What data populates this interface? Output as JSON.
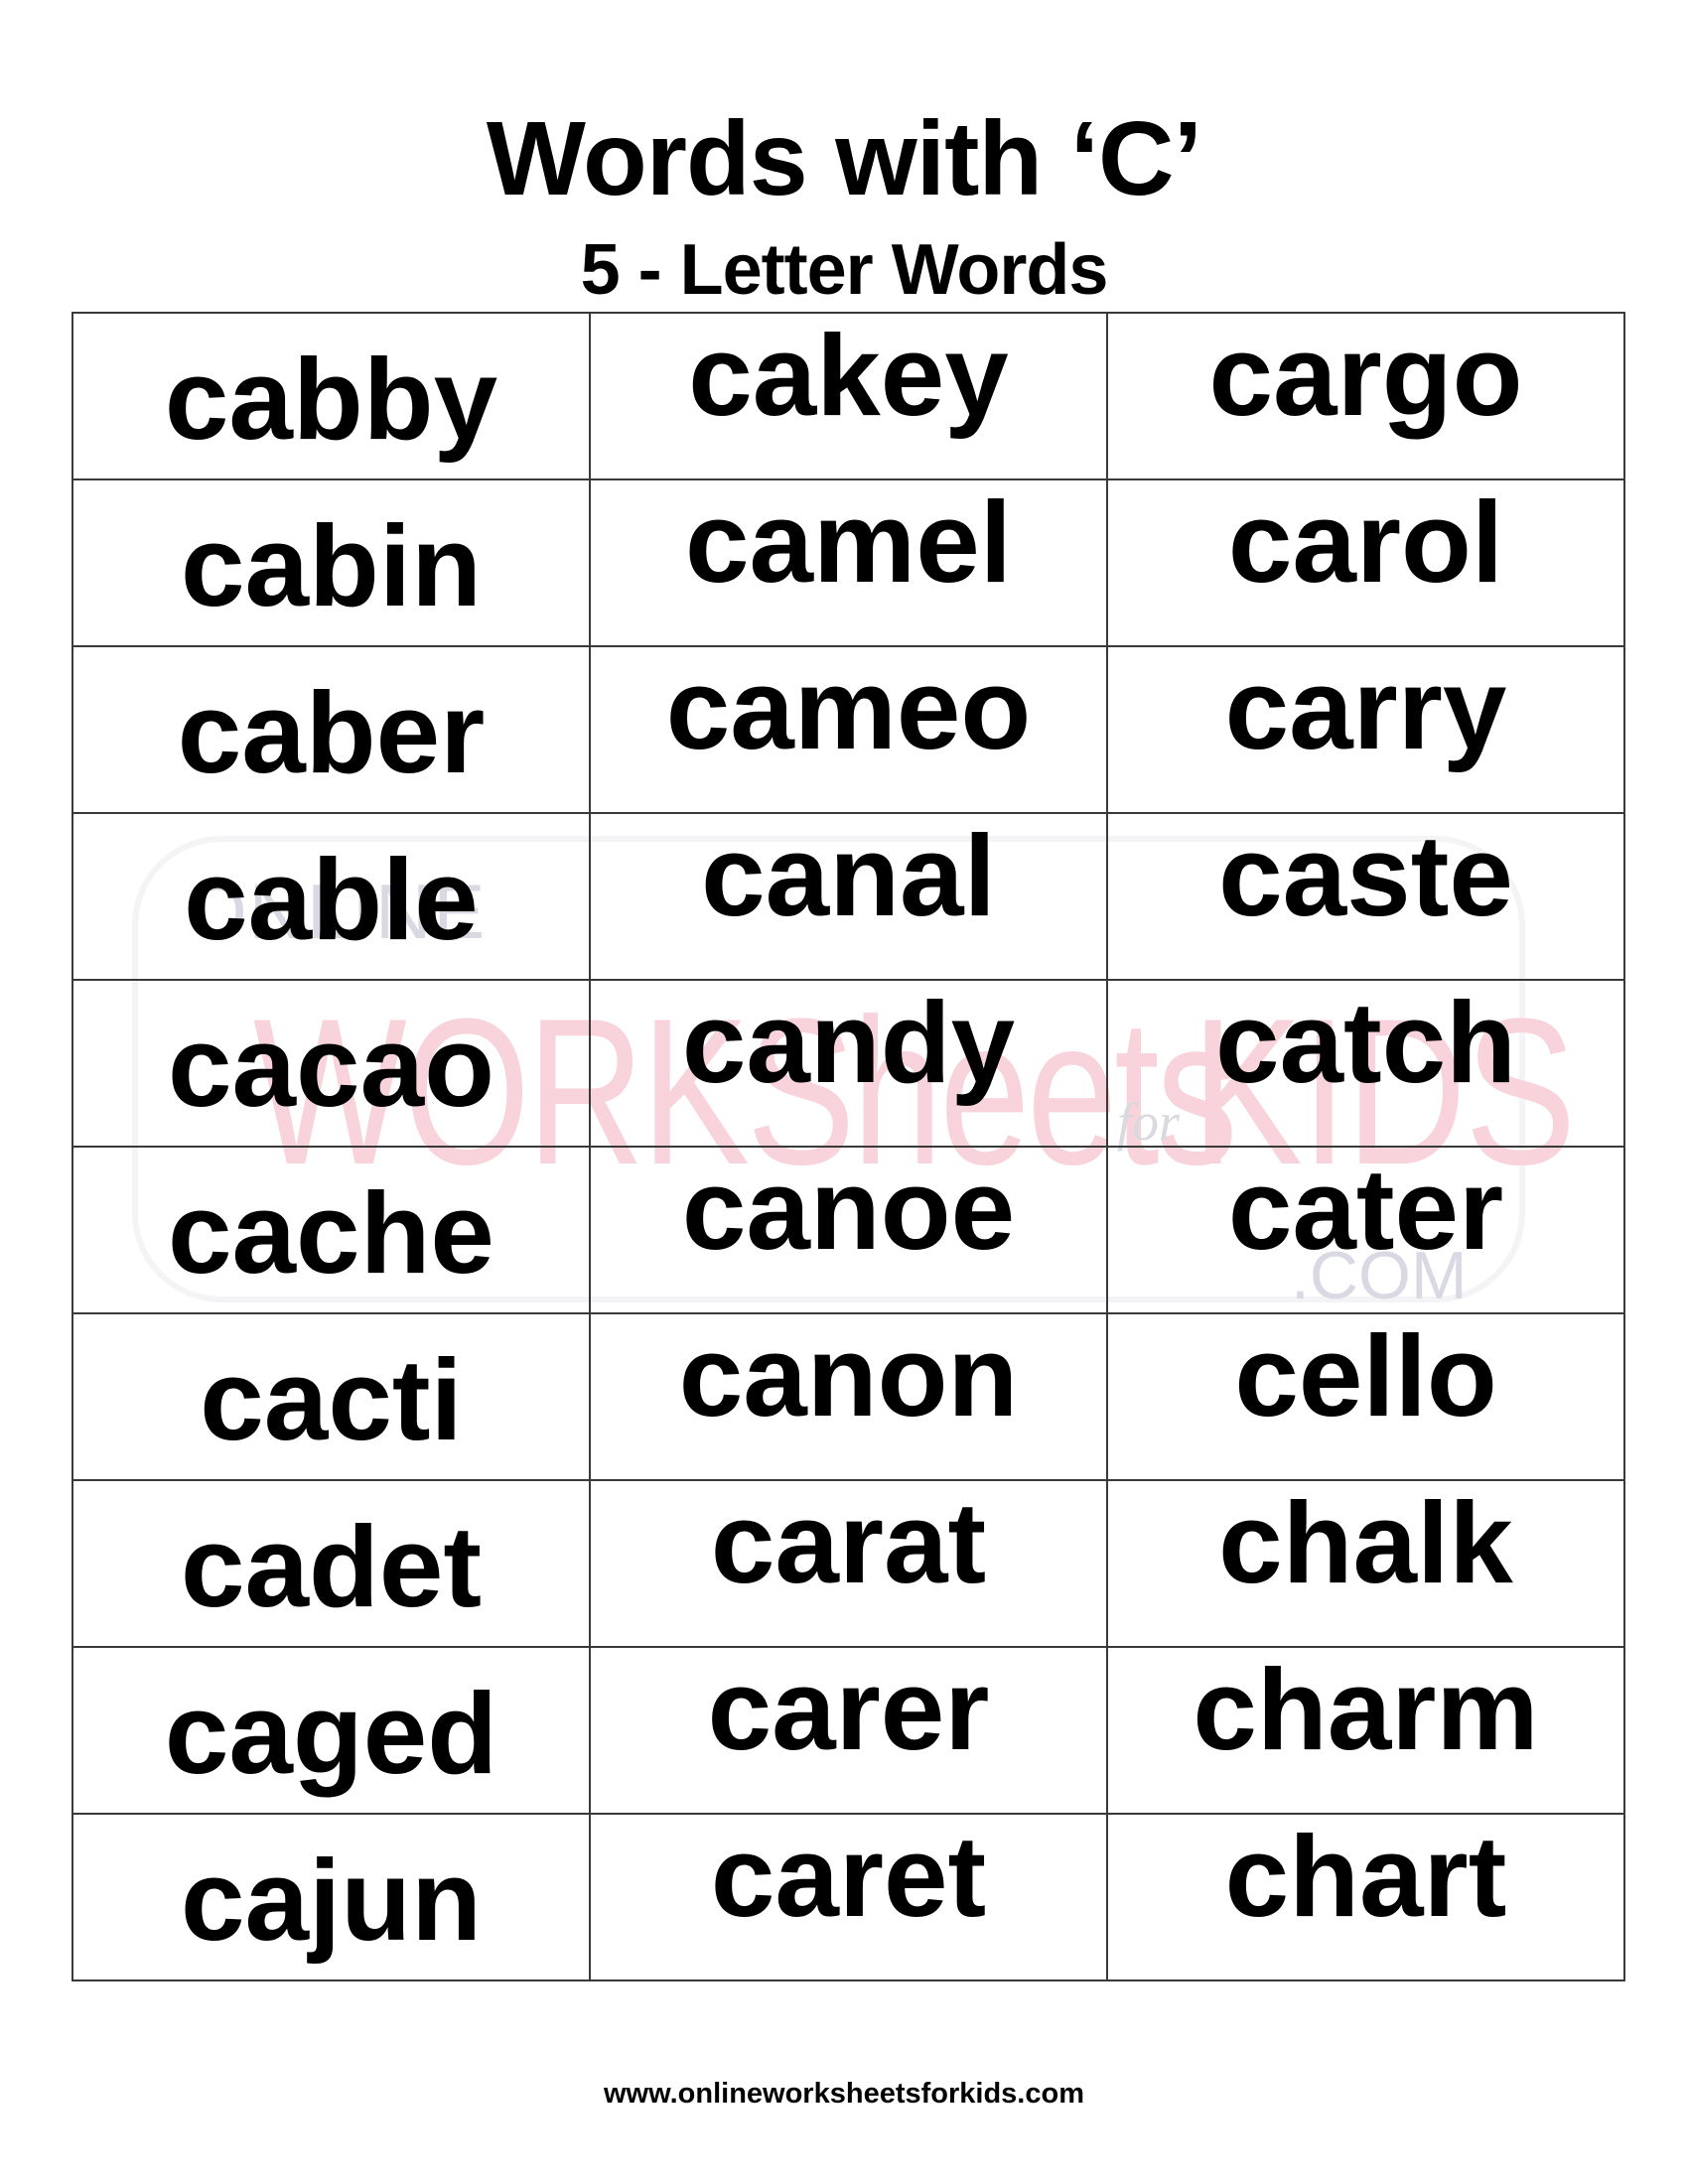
{
  "header": {
    "title": "Words with ‘C’",
    "subtitle": "5 - Letter Words"
  },
  "watermark": {
    "line1": "ONLINE",
    "line2": "WORKSheets",
    "connector": "for",
    "line3": "KIDS",
    "suffix": ".COM",
    "colors": {
      "pink": "#f9d3dc",
      "gray": "#d9d9e3"
    }
  },
  "table": {
    "rows": [
      [
        "cabby",
        "cakey",
        "cargo"
      ],
      [
        "cabin",
        "camel",
        "carol"
      ],
      [
        "caber",
        "cameo",
        "carry"
      ],
      [
        "cable",
        "canal",
        "caste"
      ],
      [
        "cacao",
        "candy",
        "catch"
      ],
      [
        "cache",
        "canoe",
        "cater"
      ],
      [
        "cacti",
        "canon",
        "cello"
      ],
      [
        "cadet",
        "carat",
        "chalk"
      ],
      [
        "caged",
        "carer",
        "charm"
      ],
      [
        "cajun",
        "caret",
        "chart"
      ]
    ]
  },
  "footer": {
    "url": "www.onlineworksheetsforkids.com"
  }
}
